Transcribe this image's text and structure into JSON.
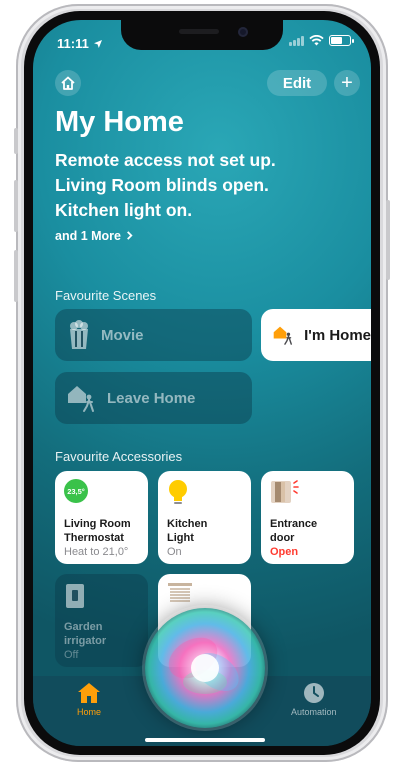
{
  "status": {
    "time": "11:11"
  },
  "header": {
    "edit_label": "Edit",
    "add_label": "+"
  },
  "home": {
    "title": "My Home",
    "summary": [
      "Remote access not set up.",
      "Living Room blinds open.",
      "Kitchen light on."
    ],
    "more_label": "and 1 More"
  },
  "scenes": {
    "section_title": "Favourite Scenes",
    "items": [
      {
        "label": "Movie",
        "icon": "popcorn-icon"
      },
      {
        "label": "I'm Home",
        "icon": "arrive-home-icon"
      },
      {
        "label": "Leave Home",
        "icon": "leave-home-icon"
      }
    ]
  },
  "accessories": {
    "section_title": "Favourite Accessories",
    "items": [
      {
        "name_line1": "Living Room",
        "name_line2": "Thermostat",
        "state": "Heat to 21,0°",
        "badge": "23,5°",
        "icon": "thermostat-icon"
      },
      {
        "name_line1": "Kitchen",
        "name_line2": "Light",
        "state": "On",
        "icon": "lightbulb-icon"
      },
      {
        "name_line1": "Entrance",
        "name_line2": "door",
        "state": "Open",
        "icon": "door-icon"
      },
      {
        "name_line1": "Garden",
        "name_line2": "irrigator",
        "state": "Off",
        "icon": "irrigator-icon"
      },
      {
        "icon": "blinds-icon"
      }
    ]
  },
  "tabs": [
    {
      "label": "Home",
      "icon": "house-icon"
    },
    {
      "label": "Automation",
      "icon": "clock-icon"
    }
  ],
  "colors": {
    "accent": "#ff9f0a",
    "green": "#3ac24a",
    "red": "#ff3b30",
    "bulb": "#ffcc00"
  }
}
